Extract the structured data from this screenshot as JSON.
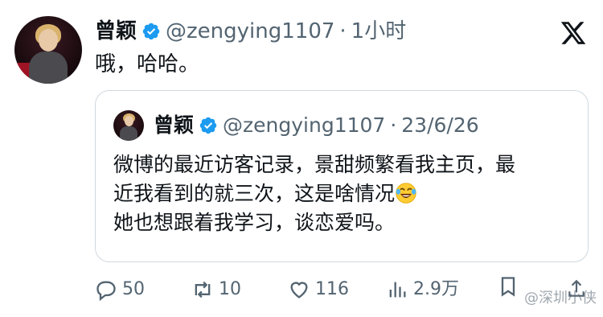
{
  "tweet": {
    "author_name": "曾颖",
    "handle": "@zengying1107",
    "separator": "·",
    "time": "1小时",
    "text": "哦，哈哈。"
  },
  "quoted": {
    "author_name": "曾颖",
    "handle": "@zengying1107",
    "separator": "·",
    "date": "23/6/26",
    "lines": [
      "微博的最近访客记录，景甜频繁看我主页，最",
      "近我看到的就三次，这是啥情况",
      "她也想跟着我学习，谈恋爱吗。"
    ]
  },
  "actions": {
    "replies": "50",
    "retweets": "10",
    "likes": "116",
    "views": "2.9万"
  },
  "watermark": "@深圳小侠",
  "colors": {
    "text": "#0f1419",
    "secondary": "#536471",
    "verified": "#1d9bf0",
    "border": "#cfd9de"
  }
}
